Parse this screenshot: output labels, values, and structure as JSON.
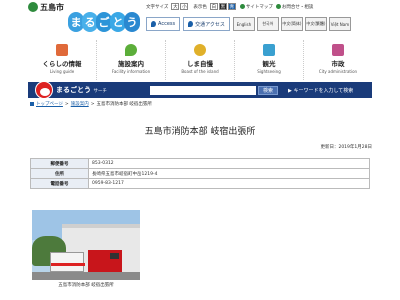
{
  "header": {
    "city_name": "五島市",
    "brand": [
      "ま",
      "る",
      "ご",
      "と",
      "う"
    ],
    "font_size_label": "文字サイズ",
    "font_size_buttons": [
      "大",
      "小"
    ],
    "display_color_label": "表示色",
    "display_color_buttons": [
      "白",
      "黒",
      "青"
    ],
    "sitemap_label": "サイトマップ",
    "contact_label": "お問合せ・相談",
    "access_label": "Access",
    "traffic_label": "交通アクセス",
    "languages": [
      "English",
      "한국어",
      "中文(简体)",
      "中文(繁體)",
      "Việt Nam"
    ]
  },
  "nav": {
    "items": [
      {
        "title": "くらしの情報",
        "sub": "Living guide",
        "color": "#e06a3a"
      },
      {
        "title": "施設案内",
        "sub": "Facility information",
        "color": "#5cae3a"
      },
      {
        "title": "しま自慢",
        "sub": "Boast of the island",
        "color": "#e0b02a"
      },
      {
        "title": "観光",
        "sub": "Sightseeing",
        "color": "#3aa0d0"
      },
      {
        "title": "市政",
        "sub": "City administration",
        "color": "#c0508a"
      }
    ]
  },
  "search": {
    "label": "まるごとう",
    "label_small": "サーチ",
    "placeholder": "",
    "button": "検索",
    "keyword_link": "キーワードを入力して検索"
  },
  "breadcrumb": {
    "items": [
      "トップページ",
      "施設案内"
    ],
    "current": "五島市消防本部 岐宿出張所"
  },
  "page": {
    "title": "五島市消防本部 岐宿出張所",
    "updated": "更新日：2019年1月28日"
  },
  "info_table": {
    "rows": [
      {
        "label": "郵便番号",
        "value": "853-0312"
      },
      {
        "label": "住所",
        "value": "長崎県五島市岐宿町中岳1219-4"
      },
      {
        "label": "電話番号",
        "value": "0959-83-1217"
      }
    ]
  },
  "photo": {
    "caption": "五島市消防本部 岐宿出張所"
  }
}
